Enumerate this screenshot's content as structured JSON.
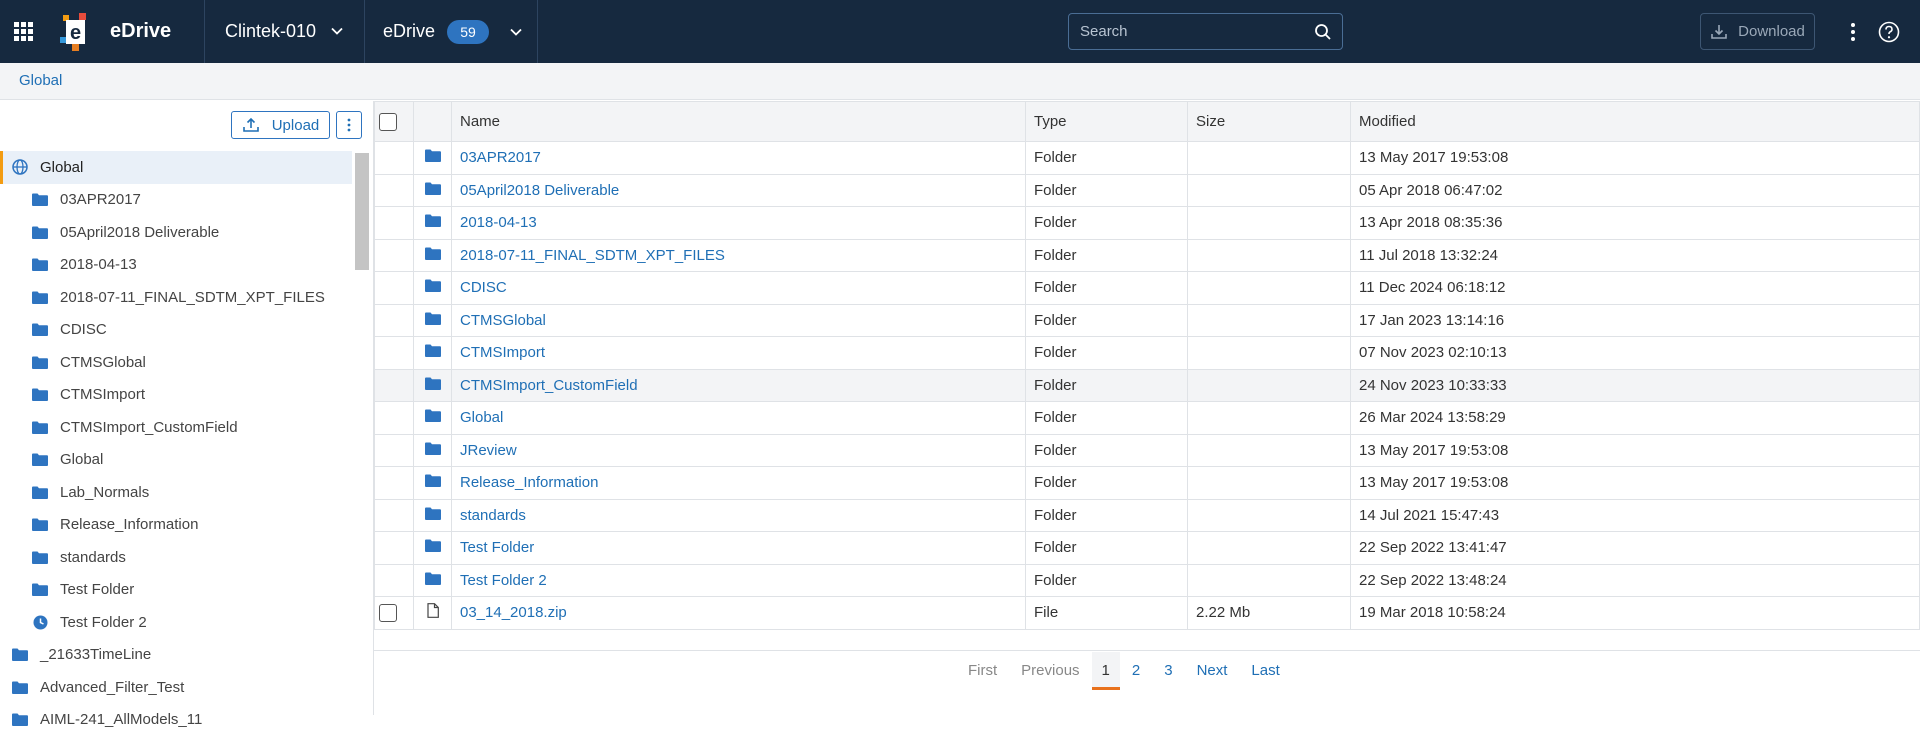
{
  "app": {
    "title": "eDrive"
  },
  "header": {
    "study": "Clintek-010",
    "drive_label": "eDrive",
    "drive_count": "59",
    "search_placeholder": "Search",
    "download_label": "Download"
  },
  "breadcrumb": {
    "current": "Global"
  },
  "tree": {
    "upload_label": "Upload",
    "root": {
      "label": "Global",
      "icon": "globe-icon"
    },
    "children": [
      {
        "label": "03APR2017",
        "icon": "folder-icon"
      },
      {
        "label": "05April2018 Deliverable",
        "icon": "folder-icon"
      },
      {
        "label": "2018-04-13",
        "icon": "folder-icon"
      },
      {
        "label": "2018-07-11_FINAL_SDTM_XPT_FILES",
        "icon": "folder-icon"
      },
      {
        "label": "CDISC",
        "icon": "folder-icon"
      },
      {
        "label": "CTMSGlobal",
        "icon": "folder-icon"
      },
      {
        "label": "CTMSImport",
        "icon": "folder-icon"
      },
      {
        "label": "CTMSImport_CustomField",
        "icon": "folder-icon"
      },
      {
        "label": "Global",
        "icon": "folder-icon"
      },
      {
        "label": "Lab_Normals",
        "icon": "folder-icon"
      },
      {
        "label": "Release_Information",
        "icon": "folder-icon"
      },
      {
        "label": "standards",
        "icon": "folder-icon"
      },
      {
        "label": "Test Folder",
        "icon": "folder-icon"
      },
      {
        "label": "Test Folder 2",
        "icon": "clock-icon"
      }
    ],
    "siblings": [
      {
        "label": "_21633TimeLine",
        "icon": "folder-icon"
      },
      {
        "label": "Advanced_Filter_Test",
        "icon": "folder-icon"
      },
      {
        "label": "AIML-241_AllModels_11",
        "icon": "folder-icon"
      }
    ]
  },
  "table": {
    "columns": [
      "Name",
      "Type",
      "Size",
      "Modified"
    ],
    "rows": [
      {
        "name": "03APR2017",
        "type": "Folder",
        "size": "",
        "modified": "13 May 2017 19:53:08",
        "icon": "folder-icon"
      },
      {
        "name": "05April2018 Deliverable",
        "type": "Folder",
        "size": "",
        "modified": "05 Apr 2018 06:47:02",
        "icon": "folder-icon"
      },
      {
        "name": "2018-04-13",
        "type": "Folder",
        "size": "",
        "modified": "13 Apr 2018 08:35:36",
        "icon": "folder-icon"
      },
      {
        "name": "2018-07-11_FINAL_SDTM_XPT_FILES",
        "type": "Folder",
        "size": "",
        "modified": "11 Jul 2018 13:32:24",
        "icon": "folder-icon"
      },
      {
        "name": "CDISC",
        "type": "Folder",
        "size": "",
        "modified": "11 Dec 2024 06:18:12",
        "icon": "folder-icon"
      },
      {
        "name": "CTMSGlobal",
        "type": "Folder",
        "size": "",
        "modified": "17 Jan 2023 13:14:16",
        "icon": "folder-icon"
      },
      {
        "name": "CTMSImport",
        "type": "Folder",
        "size": "",
        "modified": "07 Nov 2023 02:10:13",
        "icon": "folder-icon"
      },
      {
        "name": "CTMSImport_CustomField",
        "type": "Folder",
        "size": "",
        "modified": "24 Nov 2023 10:33:33",
        "icon": "folder-icon",
        "highlighted": true
      },
      {
        "name": "Global",
        "type": "Folder",
        "size": "",
        "modified": "26 Mar 2024 13:58:29",
        "icon": "folder-icon"
      },
      {
        "name": "JReview",
        "type": "Folder",
        "size": "",
        "modified": "13 May 2017 19:53:08",
        "icon": "folder-icon"
      },
      {
        "name": "Release_Information",
        "type": "Folder",
        "size": "",
        "modified": "13 May 2017 19:53:08",
        "icon": "folder-icon"
      },
      {
        "name": "standards",
        "type": "Folder",
        "size": "",
        "modified": "14 Jul 2021 15:47:43",
        "icon": "folder-icon"
      },
      {
        "name": "Test Folder",
        "type": "Folder",
        "size": "",
        "modified": "22 Sep 2022 13:41:47",
        "icon": "folder-icon"
      },
      {
        "name": "Test Folder 2",
        "type": "Folder",
        "size": "",
        "modified": "22 Sep 2022 13:48:24",
        "icon": "folder-icon"
      },
      {
        "name": "03_14_2018.zip",
        "type": "File",
        "size": "2.22 Mb",
        "modified": "19 Mar 2018 10:58:24",
        "icon": "file-icon",
        "checkbox": true
      }
    ]
  },
  "pagination": {
    "first": "First",
    "previous": "Previous",
    "pages": [
      "1",
      "2",
      "3"
    ],
    "current": "1",
    "next": "Next",
    "last": "Last"
  },
  "colors": {
    "topbar_bg": "#16293f",
    "accent": "#1f6fb5",
    "badge": "#2e74c0",
    "active_marker": "#e8711c",
    "folder": "#2e74c0"
  }
}
